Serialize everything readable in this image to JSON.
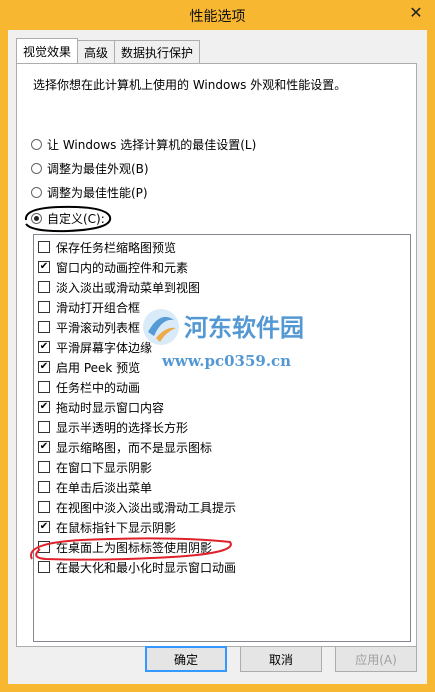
{
  "window": {
    "title": "性能选项",
    "close_glyph": "✕"
  },
  "tabs": [
    {
      "label": "视觉效果",
      "active": true
    },
    {
      "label": "高级",
      "active": false
    },
    {
      "label": "数据执行保护",
      "active": false
    }
  ],
  "description": "选择你想在此计算机上使用的 Windows 外观和性能设置。",
  "radios": [
    {
      "label": "让 Windows 选择计算机的最佳设置(L)",
      "checked": false
    },
    {
      "label": "调整为最佳外观(B)",
      "checked": false
    },
    {
      "label": "调整为最佳性能(P)",
      "checked": false
    },
    {
      "label": "自定义(C):",
      "checked": true
    }
  ],
  "options": [
    {
      "label": "保存任务栏缩略图预览",
      "checked": false
    },
    {
      "label": "窗口内的动画控件和元素",
      "checked": true
    },
    {
      "label": "淡入淡出或滑动菜单到视图",
      "checked": false
    },
    {
      "label": "滑动打开组合框",
      "checked": false
    },
    {
      "label": "平滑滚动列表框",
      "checked": false
    },
    {
      "label": "平滑屏幕字体边缘",
      "checked": true
    },
    {
      "label": "启用 Peek 预览",
      "checked": true
    },
    {
      "label": "任务栏中的动画",
      "checked": false
    },
    {
      "label": "拖动时显示窗口内容",
      "checked": true
    },
    {
      "label": "显示半透明的选择长方形",
      "checked": false
    },
    {
      "label": "显示缩略图，而不是显示图标",
      "checked": true
    },
    {
      "label": "在窗口下显示阴影",
      "checked": false
    },
    {
      "label": "在单击后淡出菜单",
      "checked": false
    },
    {
      "label": "在视图中淡入淡出或滑动工具提示",
      "checked": false
    },
    {
      "label": "在鼠标指针下显示阴影",
      "checked": true
    },
    {
      "label": "在桌面上为图标标签使用阴影",
      "checked": false
    },
    {
      "label": "在最大化和最小化时显示窗口动画",
      "checked": false
    }
  ],
  "check_glyph": "✔",
  "buttons": {
    "ok": "确定",
    "cancel": "取消",
    "apply": "应用(A)"
  },
  "watermark": {
    "name": "河东软件园",
    "url": "www.pc0359.cn"
  },
  "colors": {
    "titlebar": "#f7b731",
    "focus_border": "#3399ff",
    "annotation_black": "#000000",
    "annotation_red": "#e0202a",
    "watermark_blue": "#2a7fc9"
  }
}
